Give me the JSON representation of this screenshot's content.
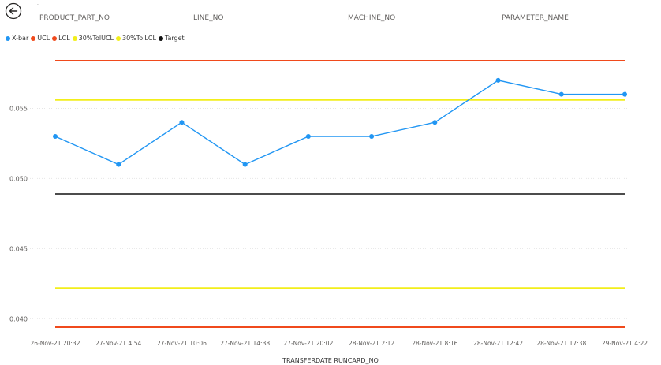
{
  "header": {
    "back_icon": "arrow-left-circle-icon",
    "corner_mark": "·",
    "fields": [
      "PRODUCT_PART_NO",
      "LINE_NO",
      "MACHINE_NO",
      "PARAMETER_NAME"
    ]
  },
  "colors": {
    "xbar": "#2196f3",
    "ucl": "#f04a1c",
    "lcl": "#f04a1c",
    "tol_ucl": "#f2ee1a",
    "tol_lcl": "#f2ee1a",
    "target": "#111111",
    "gridline": "#e6e6e6"
  },
  "chart_data": {
    "type": "line",
    "legend": [
      "X-bar",
      "UCL",
      "LCL",
      "30%TolUCL",
      "30%TolLCL",
      "Target"
    ],
    "legend_position": "top-left",
    "categories": [
      "26-Nov-21 20:32",
      "27-Nov-21 4:54",
      "27-Nov-21 10:06",
      "27-Nov-21 14:38",
      "27-Nov-21 20:02",
      "28-Nov-21 2:12",
      "28-Nov-21 8:16",
      "28-Nov-21 12:42",
      "28-Nov-21 17:38",
      "29-Nov-21 4:22"
    ],
    "series": [
      {
        "name": "X-bar",
        "values": [
          0.053,
          0.051,
          0.054,
          0.051,
          0.053,
          0.053,
          0.054,
          0.057,
          0.056,
          0.056
        ],
        "markers": true
      },
      {
        "name": "UCL",
        "values": [
          0.0584,
          0.0584,
          0.0584,
          0.0584,
          0.0584,
          0.0584,
          0.0584,
          0.0584,
          0.0584,
          0.0584
        ]
      },
      {
        "name": "LCL",
        "values": [
          0.0394,
          0.0394,
          0.0394,
          0.0394,
          0.0394,
          0.0394,
          0.0394,
          0.0394,
          0.0394,
          0.0394
        ]
      },
      {
        "name": "30%TolUCL",
        "values": [
          0.0556,
          0.0556,
          0.0556,
          0.0556,
          0.0556,
          0.0556,
          0.0556,
          0.0556,
          0.0556,
          0.0556
        ]
      },
      {
        "name": "30%TolLCL",
        "values": [
          0.0422,
          0.0422,
          0.0422,
          0.0422,
          0.0422,
          0.0422,
          0.0422,
          0.0422,
          0.0422,
          0.0422
        ]
      },
      {
        "name": "Target",
        "values": [
          0.0489,
          0.0489,
          0.0489,
          0.0489,
          0.0489,
          0.0489,
          0.0489,
          0.0489,
          0.0489,
          0.0489
        ]
      }
    ],
    "yticks": [
      "0.040",
      "0.045",
      "0.050",
      "0.055"
    ],
    "ylim": [
      0.0391,
      0.0591
    ],
    "xlabel": "TRANSFERDATE RUNCARD_NO",
    "ylabel": "",
    "grid": true
  }
}
